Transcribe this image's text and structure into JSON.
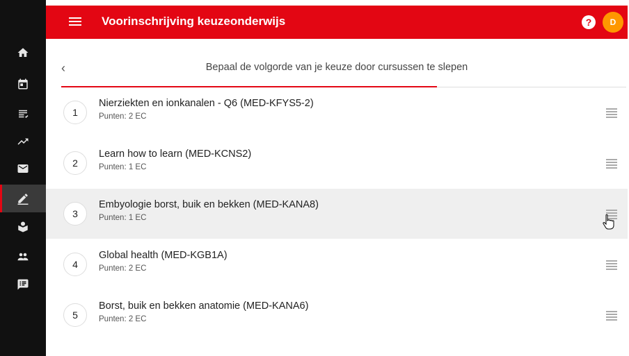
{
  "header": {
    "title": "Voorinschrijving keuzeonderwijs",
    "help_label": "?",
    "avatar_initial": "D"
  },
  "instruction": "Bepaal de volgorde van je keuze door cursussen te slepen",
  "back_label": "‹",
  "colors": {
    "brand": "#e30613",
    "avatar": "#ff9800",
    "sidebar": "#111111"
  },
  "sidebar": {
    "items": [
      "home-icon",
      "calendar-icon",
      "list-check-icon",
      "trending-up-icon",
      "mail-icon",
      "edit-icon",
      "student-icon",
      "group-icon",
      "feedback-icon"
    ],
    "active_index": 5
  },
  "courses": [
    {
      "num": "1",
      "title": "Nierziekten en ionkanalen - Q6 (MED-KFYS5-2)",
      "points": "Punten: 2 EC"
    },
    {
      "num": "2",
      "title": "Learn how to learn (MED-KCNS2)",
      "points": "Punten: 1 EC"
    },
    {
      "num": "3",
      "title": "Embyologie borst, buik en bekken (MED-KANA8)",
      "points": "Punten: 1 EC"
    },
    {
      "num": "4",
      "title": "Global health (MED-KGB1A)",
      "points": "Punten: 2 EC"
    },
    {
      "num": "5",
      "title": "Borst, buik en bekken anatomie (MED-KANA6)",
      "points": "Punten: 2 EC"
    }
  ]
}
